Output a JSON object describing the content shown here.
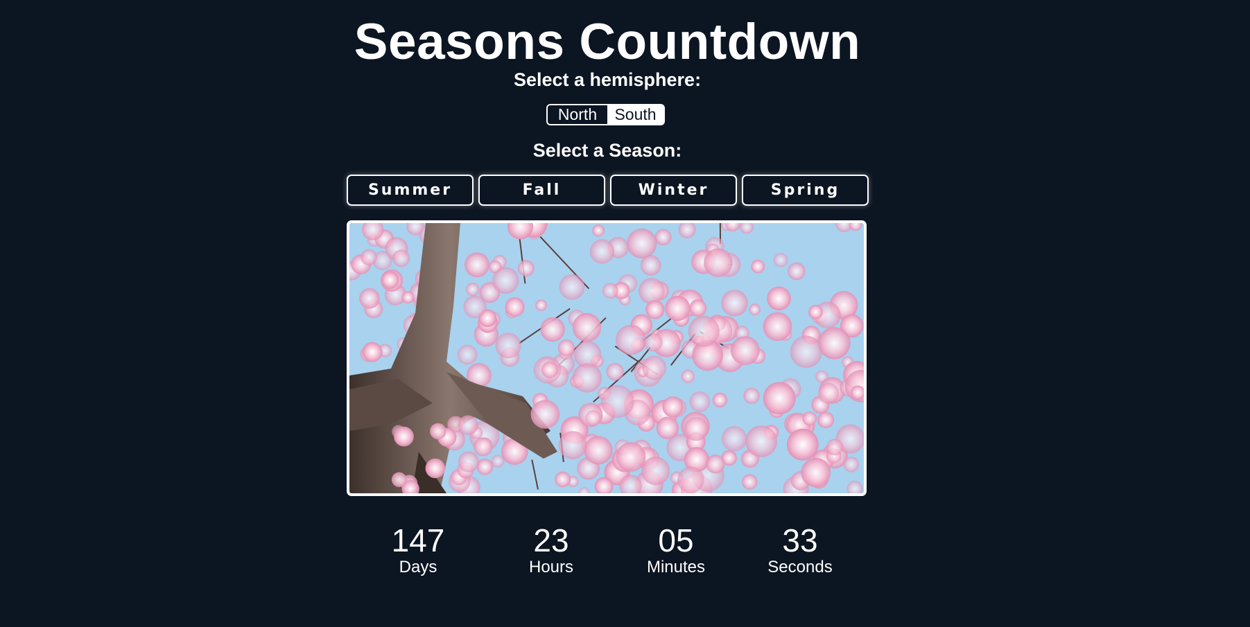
{
  "header": {
    "title": "Seasons Countdown"
  },
  "hemisphere": {
    "label": "Select a hemisphere:",
    "options": [
      "North",
      "South"
    ],
    "selected": "South"
  },
  "season": {
    "label": "Select a Season:",
    "buttons": [
      "Summer",
      "Fall",
      "Winter",
      "Spring"
    ]
  },
  "image": {
    "subject": "pink cherry blossoms against blue sky"
  },
  "countdown": {
    "days": {
      "value": "147",
      "label": "Days"
    },
    "hours": {
      "value": "23",
      "label": "Hours"
    },
    "minutes": {
      "value": "05",
      "label": "Minutes"
    },
    "seconds": {
      "value": "33",
      "label": "Seconds"
    }
  },
  "colors": {
    "background": "#0c1522",
    "foreground": "#ffffff",
    "blossom": "#f2b6cf",
    "sky": "#a9d2ee",
    "bark": "#6e5c55"
  }
}
